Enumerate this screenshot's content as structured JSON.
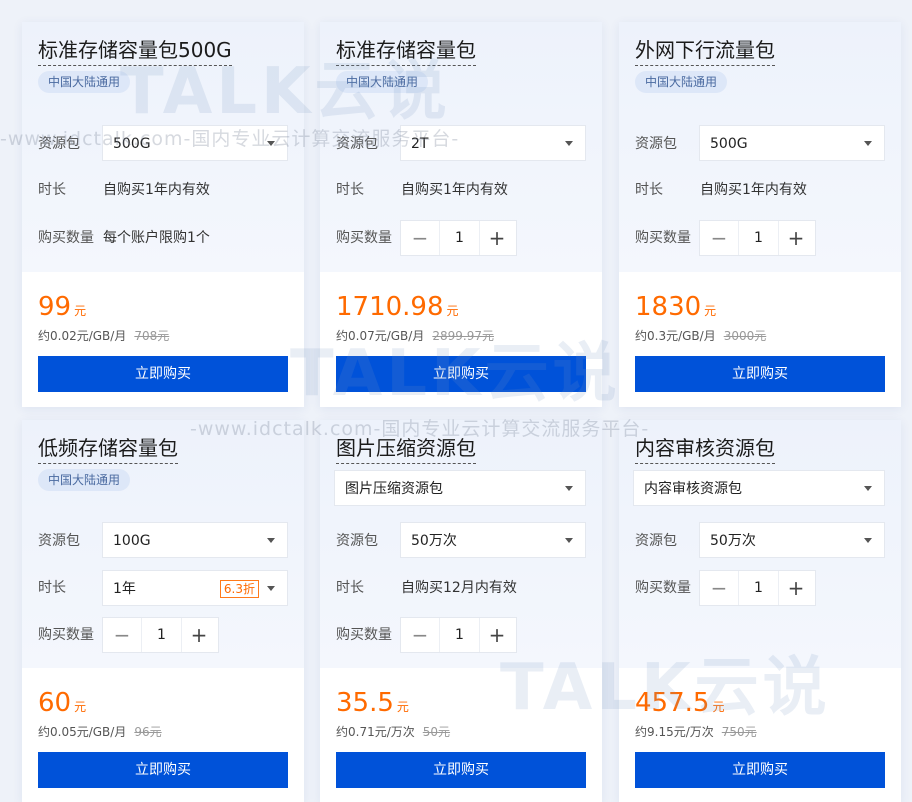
{
  "common": {
    "region_tag": "中国大陆通用",
    "label_package": "资源包",
    "label_duration": "时长",
    "label_quantity": "购买数量",
    "buy_label": "立即购买",
    "price_unit": "元",
    "minus": "−",
    "plus": "+"
  },
  "cards": [
    {
      "title": "标准存储容量包500G",
      "package_value": "500G",
      "duration_text": "自购买1年内有效",
      "quantity_text": "每个账户限购1个",
      "price": "99",
      "unit_price": "约0.02元/GB/月",
      "original_price": "708元"
    },
    {
      "title": "标准存储容量包",
      "package_value": "2T",
      "duration_text": "自购买1年内有效",
      "quantity": "1",
      "price": "1710.98",
      "unit_price": "约0.07元/GB/月",
      "original_price": "2899.97元"
    },
    {
      "title": "外网下行流量包",
      "package_value": "500G",
      "duration_text": "自购买1年内有效",
      "quantity": "1",
      "price": "1830",
      "unit_price": "约0.3元/GB/月",
      "original_price": "3000元"
    },
    {
      "title": "低频存储容量包",
      "package_value": "100G",
      "duration_value": "1年",
      "discount": "6.3折",
      "quantity": "1",
      "price": "60",
      "unit_price": "约0.05元/GB/月",
      "original_price": "96元"
    },
    {
      "title": "图片压缩资源包",
      "type_value": "图片压缩资源包",
      "package_value": "50万次",
      "duration_text": "自购买12月内有效",
      "quantity": "1",
      "price": "35.5",
      "unit_price": "约0.71元/万次",
      "original_price": "50元"
    },
    {
      "title": "内容审核资源包",
      "type_value": "内容审核资源包",
      "package_value": "50万次",
      "quantity": "1",
      "price": "457.5",
      "unit_price": "约9.15元/万次",
      "original_price": "750元"
    }
  ],
  "watermark": {
    "logo_text": "TALK云说",
    "site_text": "-www.idctalk.com-国内专业云计算交流服务平台-"
  },
  "colors": {
    "accent_blue": "#0052d9",
    "price_orange": "#ff6a00",
    "tag_bg": "#dde7f8",
    "page_bg": "#eef2f9"
  },
  "icons": {
    "dropdown": "caret-down-icon",
    "decrease": "minus-icon",
    "increase": "plus-icon"
  }
}
